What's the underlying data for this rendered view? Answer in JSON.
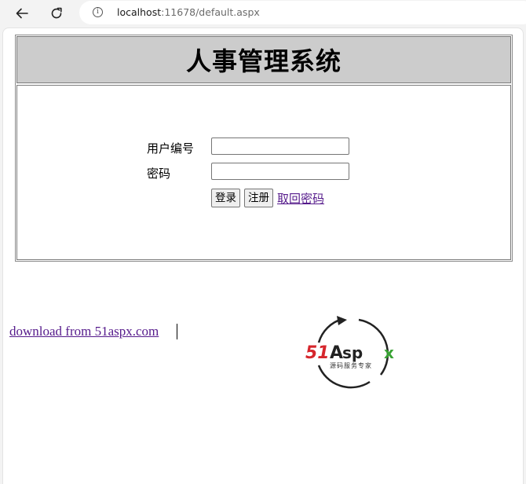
{
  "browser": {
    "url_host": "localhost",
    "url_rest": ":11678/default.aspx",
    "info_icon_glyph": "i"
  },
  "page": {
    "title": "人事管理系统",
    "login_form": {
      "user_id_label": "用户编号",
      "user_id_value": "",
      "password_label": "密码",
      "password_value": "",
      "login_button": "登录",
      "register_button": "注册",
      "retrieve_password_link": "取回密码"
    },
    "download_link": "download from 51aspx.com",
    "logo": {
      "brand_51": "51",
      "brand_a": "A",
      "brand_sp": "sp",
      "brand_x": "x",
      "tagline": "源码服务专家",
      "colors": {
        "red": "#d6262c",
        "dark": "#222222",
        "green": "#3aa335"
      }
    }
  },
  "colors": {
    "header_bg": "#cccccc",
    "visited_link": "#551a8b"
  }
}
